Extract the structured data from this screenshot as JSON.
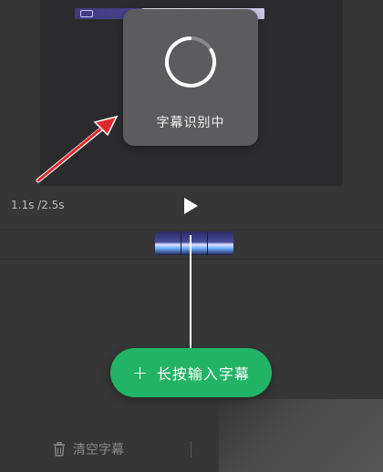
{
  "toast": {
    "message": "字幕识别中",
    "icon": "loading-spinner-icon"
  },
  "playback": {
    "time_display": "1.1s /2.5s",
    "play_icon": "play-icon"
  },
  "actions": {
    "add_subtitle_label": "长按输入字幕",
    "add_icon": "plus-icon",
    "clear_subtitles_label": "清空字幕",
    "clear_icon": "trash-icon"
  },
  "colors": {
    "accent": "#22b466",
    "background": "#363636",
    "toast_bg": "#5c5c5e",
    "annotation_arrow": "#e0262b"
  }
}
